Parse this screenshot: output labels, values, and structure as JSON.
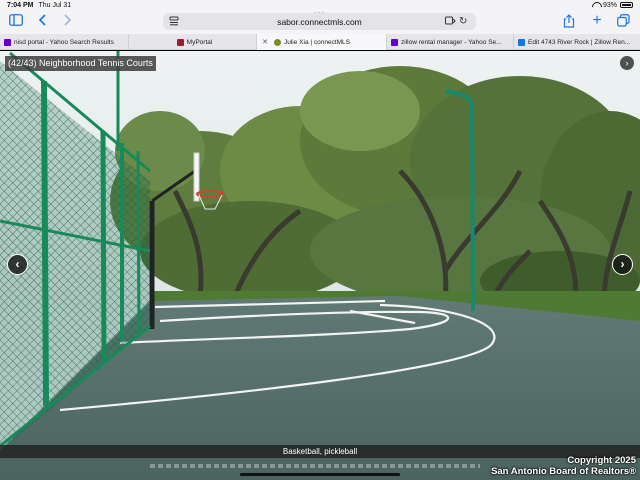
{
  "status": {
    "time": "7:04 PM",
    "date": "Thu Jul 31",
    "battery": "93%"
  },
  "browser": {
    "url": "sabor.connectmls.com",
    "tabs": [
      {
        "label": "nisd portal - Yahoo Search Results",
        "favicon_color": "#6001d2",
        "active": false
      },
      {
        "label": "MyPortal",
        "favicon_color": "#9b1c2e",
        "active": false
      },
      {
        "label": "Julie Xia | connectMLS",
        "favicon_color": "#7a8b2a",
        "active": true
      },
      {
        "label": "zillow rental manager - Yahoo Se...",
        "favicon_color": "#6001d2",
        "active": false
      },
      {
        "label": "Edit 4743 River Rock | Zillow Ren...",
        "favicon_color": "#1277e1",
        "active": false
      }
    ]
  },
  "viewer": {
    "counter": "(42/43) Neighborhood Tennis Courts",
    "caption": "Basketball, pickleball",
    "copyright_line1": "Copyright 2025",
    "copyright_line2": "San Antonio Board of Realtors®"
  },
  "icons": {
    "sidebar": "sidebar-icon",
    "back": "chevron-left-icon",
    "forward": "chevron-right-icon",
    "share": "share-icon",
    "new_tab": "plus-icon",
    "tabs_overview": "tabs-icon",
    "page_menu": "page-menu-icon",
    "translate": "translate-icon",
    "reload": "reload-icon",
    "prev": "prev-arrow-icon",
    "next": "next-arrow-icon",
    "expand": "expand-arrow-icon"
  },
  "colors": {
    "accent": "#1a73e8",
    "court": "#56706a",
    "fence": "#1d8a5c"
  }
}
